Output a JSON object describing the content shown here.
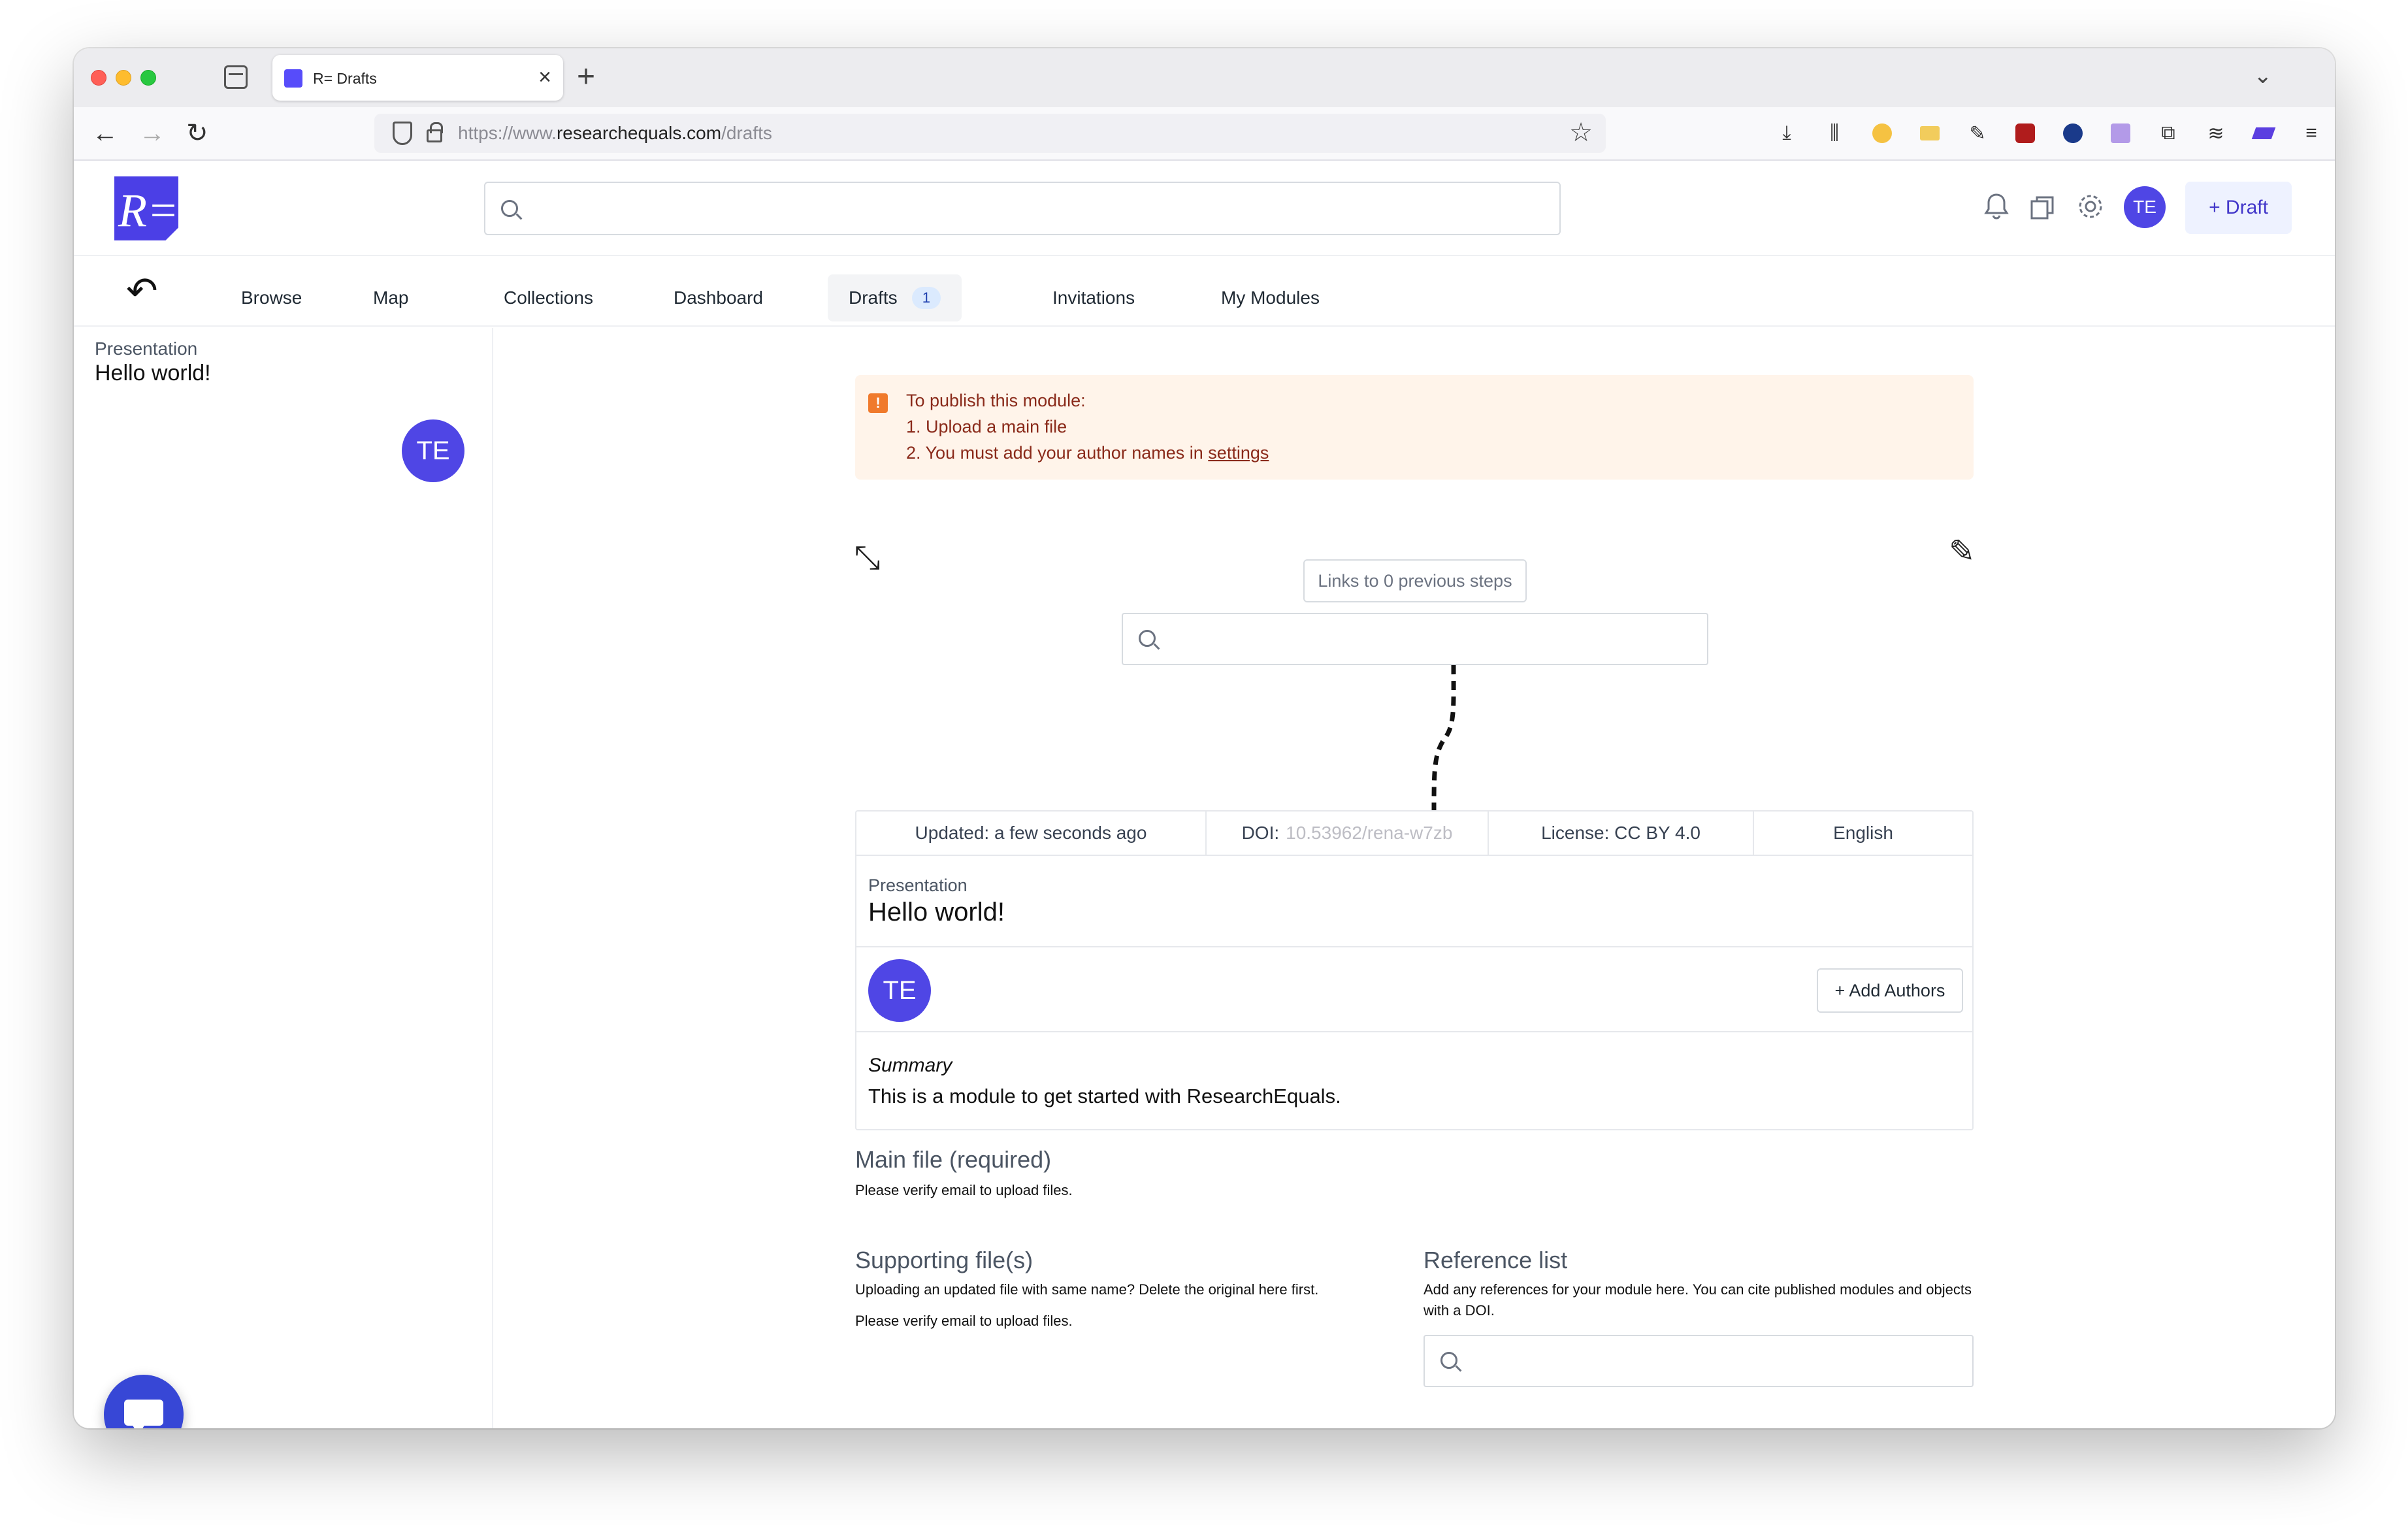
{
  "browser": {
    "tab_title": "R= Drafts",
    "url_prefix": "https://www.",
    "url_host": "researchequals.com",
    "url_path": "/drafts"
  },
  "header": {
    "logo_text": "R=",
    "search_placeholder": "",
    "user_initials": "TE",
    "draft_button": "+ Draft"
  },
  "nav": {
    "items": [
      {
        "label": "Browse"
      },
      {
        "label": "Map"
      },
      {
        "label": "Collections"
      },
      {
        "label": "Dashboard"
      },
      {
        "label": "Drafts",
        "count": "1",
        "active": true
      },
      {
        "label": "Invitations"
      },
      {
        "label": "My Modules"
      }
    ]
  },
  "sidebar": {
    "module_type": "Presentation",
    "module_title": "Hello world!",
    "author_initials": "TE"
  },
  "alert": {
    "heading": "To publish this module:",
    "step1": "1. Upload a main file",
    "step2_prefix": "2. You must add your author names in ",
    "step2_link": "settings"
  },
  "links": {
    "previous_steps": "Links to 0 previous steps"
  },
  "module": {
    "updated": "Updated: a few seconds ago",
    "doi_label": "DOI:",
    "doi_value": "10.53962/rena-w7zb",
    "license": "License: CC BY 4.0",
    "language": "English",
    "type": "Presentation",
    "title": "Hello world!",
    "author_initials": "TE",
    "add_authors": "+ Add Authors",
    "summary_label": "Summary",
    "summary_text": "This is a module to get started with ResearchEquals."
  },
  "files": {
    "main_title": "Main file (required)",
    "main_note": "Please verify email to upload files.",
    "supporting_title": "Supporting file(s)",
    "supporting_note1": "Uploading an updated file with same name? Delete the original here first.",
    "supporting_note2": "Please verify email to upload files.",
    "reference_title": "Reference list",
    "reference_note": "Add any references for your module here. You can cite published modules and objects with a DOI."
  },
  "colors": {
    "brand": "#4b3fe6",
    "avatar": "#4f46e5",
    "alert_bg": "#fff4ea",
    "alert_text": "#8a2a1a",
    "chat": "#3747d6"
  }
}
